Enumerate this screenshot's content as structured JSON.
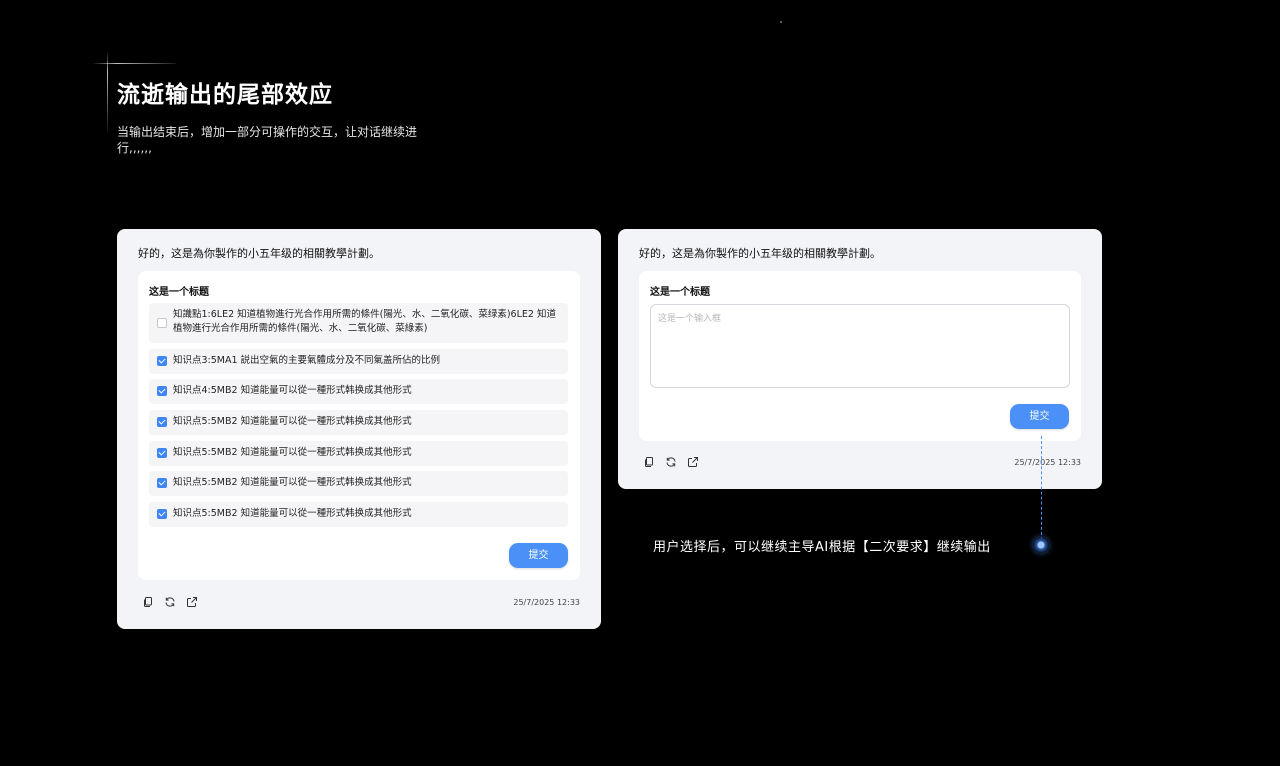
{
  "page": {
    "title": "流逝输出的尾部效应",
    "subtitle": "当输出结束后，增加一部分可操作的交互，让对话继续进行,,,,,,"
  },
  "left_card": {
    "intro": "好的，这是為你製作的小五年级的相關教學計劃。",
    "question_title": "这是一个标题",
    "options": [
      {
        "label": "知識點1:6LE2 知道植物進行光合作用所需的條件(陽光、水、二氧化碳、菜绿素)6LE2 知道植物進行光合作用所需的條件(陽光、水、二氧化碳、菜綠素)",
        "checked": false
      },
      {
        "label": "知识点3:5MA1 説出空氣的主要氣體成分及不同氣盖所佔的比例",
        "checked": true
      },
      {
        "label": "知识点4:5MB2 知道能量可以從一種形式韩换成其他形式",
        "checked": true
      },
      {
        "label": "知识点5:5MB2 知道能量可以從一種形式韩换成其他形式",
        "checked": true
      },
      {
        "label": "知识点5:5MB2 知道能量可以從一種形式韩换成其他形式",
        "checked": true
      },
      {
        "label": "知识点5:5MB2 知道能量可以從一種形式韩换成其他形式",
        "checked": true
      },
      {
        "label": "知识点5:5MB2 知道能量可以從一種形式韩换成其他形式",
        "checked": true
      }
    ],
    "submit_label": "提交",
    "timestamp": "25/7/2025  12:33"
  },
  "right_card": {
    "intro": "好的，这是為你製作的小五年级的相關教學計劃。",
    "question_title": "这是一个标题",
    "input_placeholder": "这是一个输入框",
    "input_value": "",
    "submit_label": "提交",
    "timestamp": "25/7/2025  12:33"
  },
  "annotation": {
    "text": "用户选择后，可以继续主导AI根据【二次要求】继续输出"
  },
  "toolbar_icons": [
    "copy-icon",
    "refresh-icon",
    "share-icon"
  ],
  "colors": {
    "background": "#000000",
    "card": "#f3f4f8",
    "accent": "#4a90f7",
    "checkbox": "#3f86f5"
  }
}
